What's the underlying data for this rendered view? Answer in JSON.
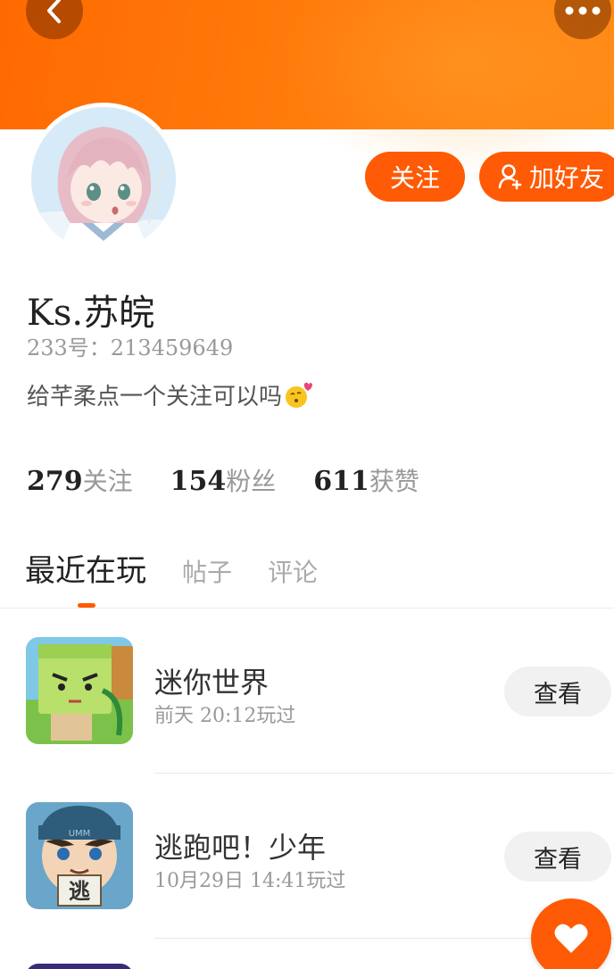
{
  "header": {
    "back_icon": "chevron-left-icon",
    "more_icon": "more-dots-icon",
    "banner_color": "#ff7a0a"
  },
  "profile": {
    "avatar_icon": "anime-girl-avatar",
    "username": "Ks.苏皖",
    "user_id": "233号：213459649",
    "bio": "给芊柔点一个关注可以吗",
    "bio_emoji": "kissing-face-emoji"
  },
  "actions": {
    "follow_label": "关注",
    "add_friend_label": "加好友",
    "accent": "#ff5a05"
  },
  "stats": [
    {
      "num": "279",
      "label": "关注"
    },
    {
      "num": "154",
      "label": "粉丝"
    },
    {
      "num": "611",
      "label": "获赞"
    }
  ],
  "tabs": [
    {
      "label": "最近在玩",
      "active": true
    },
    {
      "label": "帖子",
      "active": false
    },
    {
      "label": "评论",
      "active": false
    }
  ],
  "games": [
    {
      "title": "迷你世界",
      "time": "前天  20:12玩过",
      "button": "查看"
    },
    {
      "title": "逃跑吧！少年",
      "time": "10月29日  14:41玩过",
      "button": "查看"
    }
  ],
  "game2_sign": "逃",
  "game2_cap": "UMM",
  "fab_icon": "heart-icon"
}
